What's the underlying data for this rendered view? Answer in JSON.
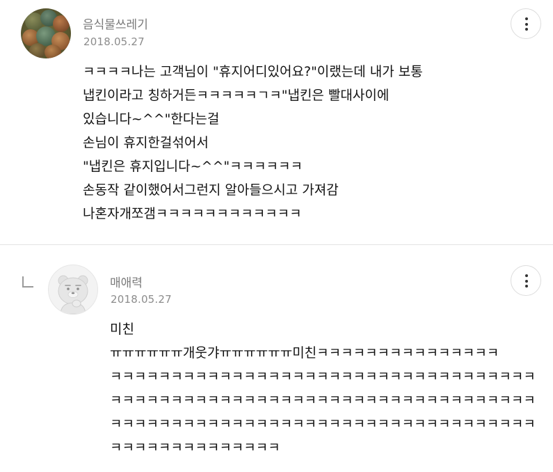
{
  "comments": [
    {
      "username": "음식물쓰레기",
      "date": "2018.05.27",
      "avatar": "food-photo-avatar",
      "lines": [
        "ㅋㅋㅋㅋ나는 고객님이 \"휴지어디있어요?\"이랬는데 내가 보통",
        "냅킨이라고 칭하거든ㅋㅋㅋㅋㅋㄱㅋ\"냅킨은 빨대사이에",
        "있습니다~^^\"한다는걸",
        "손님이 휴지한걸섞어서",
        "\"냅킨은 휴지입니다~^^\"ㅋㅋㅋㅋㅋㅋ",
        "손동작 같이했어서그런지 알아들으시고 가져감",
        "나혼자개쪼갬ㅋㅋㅋㅋㅋㅋㅋㅋㅋㅋㅋㅋ"
      ]
    },
    {
      "username": "매애력",
      "date": "2018.05.27",
      "avatar": "character-avatar",
      "is_reply": true,
      "lines": [
        "미친",
        "ㅠㅠㅠㅠㅠㅠ개웃갸ㅠㅠㅠㅠㅠㅠ미친ㅋㅋㅋㅋㅋㅋㅋㅋㅋㅋㅋㅋㅋㅋㅋ",
        "ㅋㅋㅋㅋㅋㅋㅋㅋㅋㅋㅋㅋㅋㅋㅋㅋㅋㅋㅋㅋㅋㅋㅋㅋㅋㅋㅋㅋㅋㅋㅋㅋㅋㅋㅋ",
        "ㅋㅋㅋㅋㅋㅋㅋㅋㅋㅋㅋㅋㅋㅋㅋㅋㅋㅋㅋㅋㅋㅋㅋㅋㅋㅋㅋㅋㅋㅋㅋㅋㅋㅋㅋ",
        "ㅋㅋㅋㅋㅋㅋㅋㅋㅋㅋㅋㅋㅋㅋㅋㅋㅋㅋㅋㅋㅋㅋㅋㅋㅋㅋㅋㅋㅋㅋㅋㅋㅋㅋㅋ",
        "ㅋㅋㅋㅋㅋㅋㅋㅋㅋㅋㅋㅋㅋㅋ"
      ]
    }
  ],
  "icons": {
    "more": "more-vertical-icon",
    "reply": "reply-arrow-icon"
  },
  "colors": {
    "username": "#7a7a7a",
    "date": "#8c8c8c",
    "text": "#111111",
    "divider": "#e3e3e3"
  }
}
